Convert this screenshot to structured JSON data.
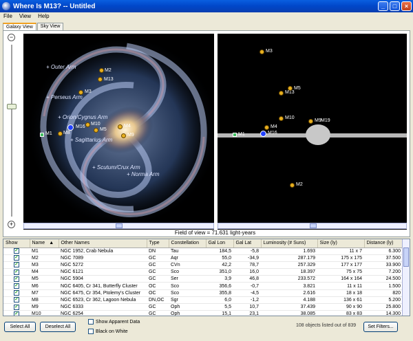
{
  "window": {
    "title": "Where Is M13? -- Untitled"
  },
  "menu": [
    "File",
    "View",
    "Help"
  ],
  "tabs": [
    {
      "label": "Galaxy View",
      "active": true
    },
    {
      "label": "Sky View",
      "active": false
    }
  ],
  "galaxy": {
    "arm_labels": [
      "+ Outer Arm",
      "+ Perseus Arm",
      "+ Orion/Cygnus Arm",
      "+ Sagittarius Arm",
      "+ Scutum/Crux Arm",
      "+ Norma Arm"
    ],
    "markers": [
      "M2",
      "M13",
      "M3",
      "M10",
      "M5",
      "M4",
      "M16",
      "M1",
      "M8",
      "M9"
    ]
  },
  "sky": {
    "markers": [
      "M3",
      "M13",
      "M5",
      "M10",
      "M9",
      "M19",
      "M4",
      "M1",
      "M16",
      "M2"
    ]
  },
  "fov": "Field of view = 71.631 light-years",
  "table": {
    "headers": [
      "Show",
      "Name",
      "Other Names",
      "Type",
      "Constellation",
      "Gal Lon",
      "Gal Lat",
      "Luminosity (# Suns)",
      "Size (ly)",
      "Distance (ly)"
    ],
    "sort_indicator": "▲",
    "rows": [
      {
        "name": "M1",
        "other": "NGC 1952,  Crab Nebula",
        "type": "DN",
        "con": "Tau",
        "lon": "184,5",
        "lat": "-5,8",
        "lum": "1.693",
        "size": "11 x 7",
        "dist": "6.300"
      },
      {
        "name": "M2",
        "other": "NGC 7089",
        "type": "GC",
        "con": "Aqr",
        "lon": "55,0",
        "lat": "-34,9",
        "lum": "287.179",
        "size": "175 x 175",
        "dist": "37.500"
      },
      {
        "name": "M3",
        "other": "NGC 5272",
        "type": "GC",
        "con": "CVn",
        "lon": "42,2",
        "lat": "78,7",
        "lum": "257.329",
        "size": "177 x 177",
        "dist": "33.900"
      },
      {
        "name": "M4",
        "other": "NGC 6121",
        "type": "GC",
        "con": "Sco",
        "lon": "351,0",
        "lat": "16,0",
        "lum": "18.397",
        "size": "75 x 75",
        "dist": "7.200"
      },
      {
        "name": "M5",
        "other": "NGC 5904",
        "type": "GC",
        "con": "Ser",
        "lon": "3,9",
        "lat": "46,8",
        "lum": "233.572",
        "size": "164 x 164",
        "dist": "24.500"
      },
      {
        "name": "M6",
        "other": "NGC 6405,  Cr 341,  Butterfly Cluster",
        "type": "OC",
        "con": "Sco",
        "lon": "356,6",
        "lat": "-0,7",
        "lum": "3.821",
        "size": "11 x 11",
        "dist": "1.500"
      },
      {
        "name": "M7",
        "other": "NGC 6475,  Cr 354,  Ptolemy's Cluster",
        "type": "OC",
        "con": "Sco",
        "lon": "355,8",
        "lat": "-4,5",
        "lum": "2.616",
        "size": "18 x 18",
        "dist": "820"
      },
      {
        "name": "M8",
        "other": "NGC 6523,  Cr 362,  Lagoon Nebula",
        "type": "DN,OC",
        "con": "Sgr",
        "lon": "6,0",
        "lat": "-1,2",
        "lum": "4.188",
        "size": "136 x 61",
        "dist": "5.200"
      },
      {
        "name": "M9",
        "other": "NGC 6333",
        "type": "GC",
        "con": "Oph",
        "lon": "5,5",
        "lat": "10,7",
        "lum": "37.439",
        "size": "90 x 90",
        "dist": "25.800"
      },
      {
        "name": "M10",
        "other": "NGC 6254",
        "type": "GC",
        "con": "Oph",
        "lon": "15,1",
        "lat": "23,1",
        "lum": "38.085",
        "size": "83 x 83",
        "dist": "14.300"
      }
    ]
  },
  "buttons": {
    "select_all": "Select All",
    "deselect_all": "Deselect All",
    "set_filters": "Set Filters..."
  },
  "checkboxes": {
    "apparent": "Show Apparent Data",
    "black_on_white": "Black on White"
  },
  "status": "108 objects listed out of 839",
  "colors": {
    "titlebar": "#0046c8",
    "marker": "#e8b020",
    "sun": "#2040ff"
  }
}
